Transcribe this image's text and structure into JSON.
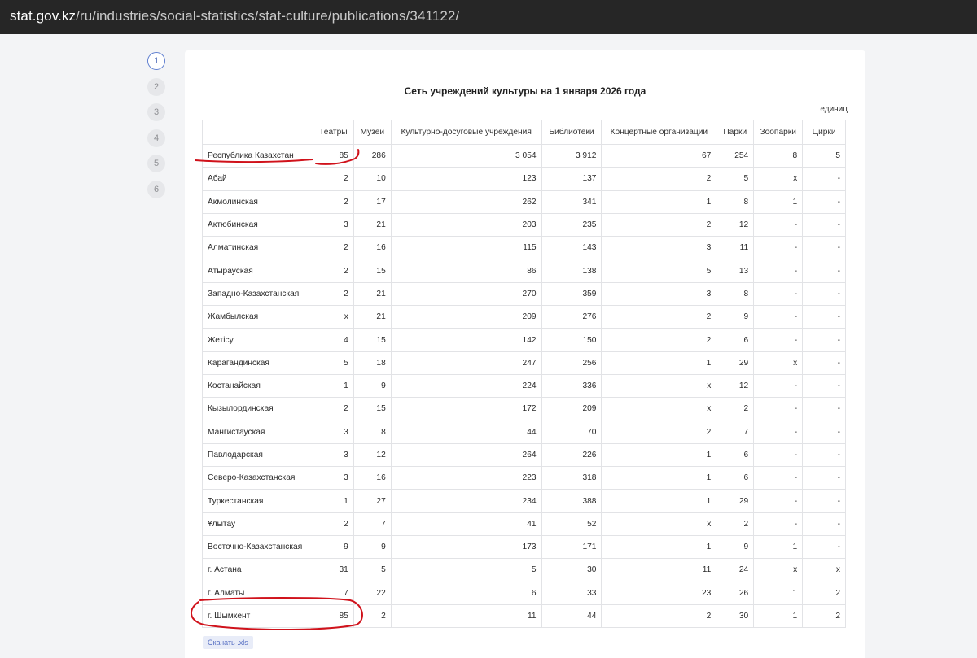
{
  "browser": {
    "url_host": "stat.gov.kz",
    "url_path": "/ru/industries/social-statistics/stat-culture/publications/341122/"
  },
  "pagination": [
    "1",
    "2",
    "3",
    "4",
    "5",
    "6"
  ],
  "table": {
    "title": "Сеть учреждений культуры на 1 января 2026 года",
    "unit": "единиц",
    "headers": [
      "",
      "Театры",
      "Музеи",
      "Культурно-досуговые учреждения",
      "Библиотеки",
      "Концертные организации",
      "Парки",
      "Зоопарки",
      "Цирки"
    ],
    "rows": [
      [
        "Республика Казахстан",
        "85",
        "286",
        "3 054",
        "3 912",
        "67",
        "254",
        "8",
        "5"
      ],
      [
        "Абай",
        "2",
        "10",
        "123",
        "137",
        "2",
        "5",
        "x",
        "-"
      ],
      [
        "Акмолинская",
        "2",
        "17",
        "262",
        "341",
        "1",
        "8",
        "1",
        "-"
      ],
      [
        "Актюбинская",
        "3",
        "21",
        "203",
        "235",
        "2",
        "12",
        "-",
        "-"
      ],
      [
        "Алматинская",
        "2",
        "16",
        "115",
        "143",
        "3",
        "11",
        "-",
        "-"
      ],
      [
        "Атырауская",
        "2",
        "15",
        "86",
        "138",
        "5",
        "13",
        "-",
        "-"
      ],
      [
        "Западно-Казахстанская",
        "2",
        "21",
        "270",
        "359",
        "3",
        "8",
        "-",
        "-"
      ],
      [
        "Жамбылская",
        "x",
        "21",
        "209",
        "276",
        "2",
        "9",
        "-",
        "-"
      ],
      [
        "Жетісу",
        "4",
        "15",
        "142",
        "150",
        "2",
        "6",
        "-",
        "-"
      ],
      [
        "Карагандинская",
        "5",
        "18",
        "247",
        "256",
        "1",
        "29",
        "x",
        "-"
      ],
      [
        "Костанайская",
        "1",
        "9",
        "224",
        "336",
        "x",
        "12",
        "-",
        "-"
      ],
      [
        "Кызылординская",
        "2",
        "15",
        "172",
        "209",
        "x",
        "2",
        "-",
        "-"
      ],
      [
        "Мангистауская",
        "3",
        "8",
        "44",
        "70",
        "2",
        "7",
        "-",
        "-"
      ],
      [
        "Павлодарская",
        "3",
        "12",
        "264",
        "226",
        "1",
        "6",
        "-",
        "-"
      ],
      [
        "Северо-Казахстанская",
        "3",
        "16",
        "223",
        "318",
        "1",
        "6",
        "-",
        "-"
      ],
      [
        "Туркестанская",
        "1",
        "27",
        "234",
        "388",
        "1",
        "29",
        "-",
        "-"
      ],
      [
        "Ұлытау",
        "2",
        "7",
        "41",
        "52",
        "x",
        "2",
        "-",
        "-"
      ],
      [
        "Восточно-Казахстанская",
        "9",
        "9",
        "173",
        "171",
        "1",
        "9",
        "1",
        "-"
      ],
      [
        "г. Астана",
        "31",
        "5",
        "5",
        "30",
        "11",
        "24",
        "x",
        "x"
      ],
      [
        "г. Алматы",
        "7",
        "22",
        "6",
        "33",
        "23",
        "26",
        "1",
        "2"
      ],
      [
        "г. Шымкент",
        "85",
        "2",
        "11",
        "44",
        "2",
        "30",
        "1",
        "2"
      ]
    ]
  },
  "download_label": "Скачать .xls",
  "colors": {
    "annotation": "#d0121b",
    "pager_active": "#5f7fd0"
  }
}
